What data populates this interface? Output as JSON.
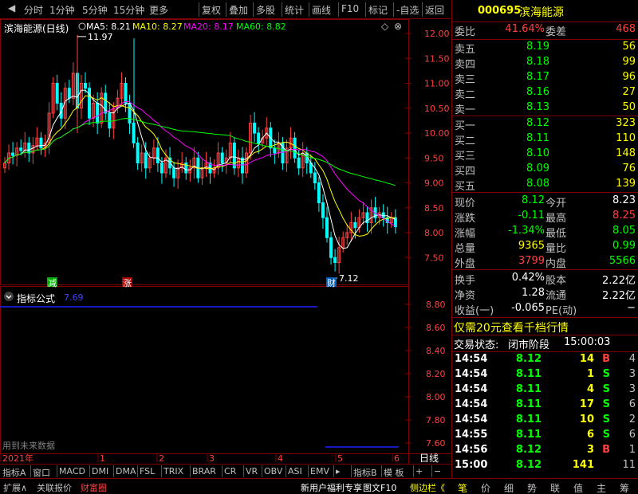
{
  "toolbar": {
    "left_items": [
      "分时",
      "1分钟",
      "5分钟",
      "15分钟",
      "更多"
    ],
    "right_items": [
      "复权",
      "叠加",
      "多股",
      "统计",
      "画线",
      "F10",
      "标记",
      "-自选",
      "返回"
    ]
  },
  "chart": {
    "stock_title": "滨海能源(日线)",
    "ma": [
      {
        "label": "MA5: 8.21",
        "color": "#ffffff"
      },
      {
        "label": "MA10: 8.27",
        "color": "#ffff00"
      },
      {
        "label": "MA20: 8.17",
        "color": "#ff00ff"
      },
      {
        "label": "MA60: 8.82",
        "color": "#00ff00"
      }
    ],
    "high_label": "11.97",
    "low_label": "7.12",
    "price_ticks": [
      "12.00",
      "11.50",
      "11.00",
      "10.50",
      "10.00",
      "9.50",
      "9.00",
      "8.50",
      "8.00",
      "7.50"
    ],
    "markers": [
      {
        "text": "减",
        "color": "#00aa00"
      },
      {
        "text": "涨",
        "color": "#aa0000"
      },
      {
        "text": "财",
        "color": "#0060c0"
      }
    ],
    "indicator_title": "指标公式",
    "indicator_value": "7.69",
    "indicator_ticks": [
      "8.80",
      "8.60",
      "8.40",
      "8.20",
      "8.00",
      "7.80",
      "7.60"
    ],
    "future_data_note": "用到未来数据",
    "x_labels": [
      "2021年",
      "1",
      "2",
      "3",
      "4",
      "5",
      "6"
    ],
    "period_label": "日线"
  },
  "bottom_tabs": [
    "指标A",
    "窗口",
    "MACD",
    "DMI",
    "DMA",
    "FSL",
    "TRIX",
    "BRAR",
    "CR",
    "VR",
    "OBV",
    "ASI",
    "EMV",
    "▸",
    "指标B",
    "模 板",
    "+",
    "−"
  ],
  "status_bar": {
    "left": [
      "扩展∧",
      "关联报价",
      "财富圈"
    ],
    "middle": [
      "新用户福利专享",
      "图文F10",
      "侧边栏《"
    ],
    "right": [
      "笔",
      "价",
      "细",
      "势",
      "联",
      "值",
      "主",
      "筹"
    ]
  },
  "quote": {
    "code": "000695",
    "name": "滨海能源",
    "weibi_label": "委比",
    "weibi_value": "41.64%",
    "weicha_label": "委差",
    "weicha_value": "468",
    "sell": [
      {
        "label": "卖五",
        "price": "8.19",
        "vol": "56"
      },
      {
        "label": "卖四",
        "price": "8.18",
        "vol": "99"
      },
      {
        "label": "卖三",
        "price": "8.17",
        "vol": "96"
      },
      {
        "label": "卖二",
        "price": "8.16",
        "vol": "27"
      },
      {
        "label": "卖一",
        "price": "8.13",
        "vol": "50"
      }
    ],
    "buy": [
      {
        "label": "买一",
        "price": "8.12",
        "vol": "323"
      },
      {
        "label": "买二",
        "price": "8.11",
        "vol": "110"
      },
      {
        "label": "买三",
        "price": "8.10",
        "vol": "148"
      },
      {
        "label": "买四",
        "price": "8.09",
        "vol": "76"
      },
      {
        "label": "买五",
        "price": "8.08",
        "vol": "139"
      }
    ],
    "stats": [
      {
        "l1": "现价",
        "v1": "8.12",
        "c1": "#00ff00",
        "l2": "今开",
        "v2": "8.23",
        "c2": "#ffffff"
      },
      {
        "l1": "涨跌",
        "v1": "-0.11",
        "c1": "#00ff00",
        "l2": "最高",
        "v2": "8.25",
        "c2": "#ff4040"
      },
      {
        "l1": "涨幅",
        "v1": "-1.34%",
        "c1": "#00ff00",
        "l2": "最低",
        "v2": "8.05",
        "c2": "#00ff00"
      },
      {
        "l1": "总量",
        "v1": "9365",
        "c1": "#ffff00",
        "l2": "量比",
        "v2": "0.99",
        "c2": "#00ff00"
      },
      {
        "l1": "外盘",
        "v1": "3799",
        "c1": "#ff4040",
        "l2": "内盘",
        "v2": "5566",
        "c2": "#00ff00"
      }
    ],
    "stats2": [
      {
        "l1": "换手",
        "v1": "0.42%",
        "l2": "股本",
        "v2": "2.22亿"
      },
      {
        "l1": "净资",
        "v1": "1.28",
        "l2": "流通",
        "v2": "2.22亿"
      },
      {
        "l1": "收益(一)",
        "v1": "-0.065",
        "l2": "PE(动)",
        "v2": "−"
      }
    ],
    "promo": "仅需20元查看千档行情",
    "trade_status_label": "交易状态:",
    "trade_status_value": "闭市阶段",
    "trade_status_time": "15:00:03",
    "ticks": [
      {
        "time": "14:54",
        "price": "8.12",
        "vol": "14",
        "bs": "B",
        "n": "4"
      },
      {
        "time": "14:54",
        "price": "8.11",
        "vol": "1",
        "bs": "S",
        "n": "3"
      },
      {
        "time": "14:54",
        "price": "8.11",
        "vol": "4",
        "bs": "S",
        "n": "3"
      },
      {
        "time": "14:54",
        "price": "8.11",
        "vol": "17",
        "bs": "S",
        "n": "6"
      },
      {
        "time": "14:54",
        "price": "8.11",
        "vol": "10",
        "bs": "S",
        "n": "2"
      },
      {
        "time": "14:55",
        "price": "8.11",
        "vol": "6",
        "bs": "S",
        "n": "6"
      },
      {
        "time": "14:56",
        "price": "8.12",
        "vol": "3",
        "bs": "B",
        "n": "1"
      },
      {
        "time": "15:00",
        "price": "8.12",
        "vol": "141",
        "bs": "",
        "n": "11"
      }
    ]
  },
  "colors": {
    "up": "#ff4040",
    "down": "#00ff00",
    "grid": "#800000",
    "accent_yellow": "#ffff00"
  }
}
